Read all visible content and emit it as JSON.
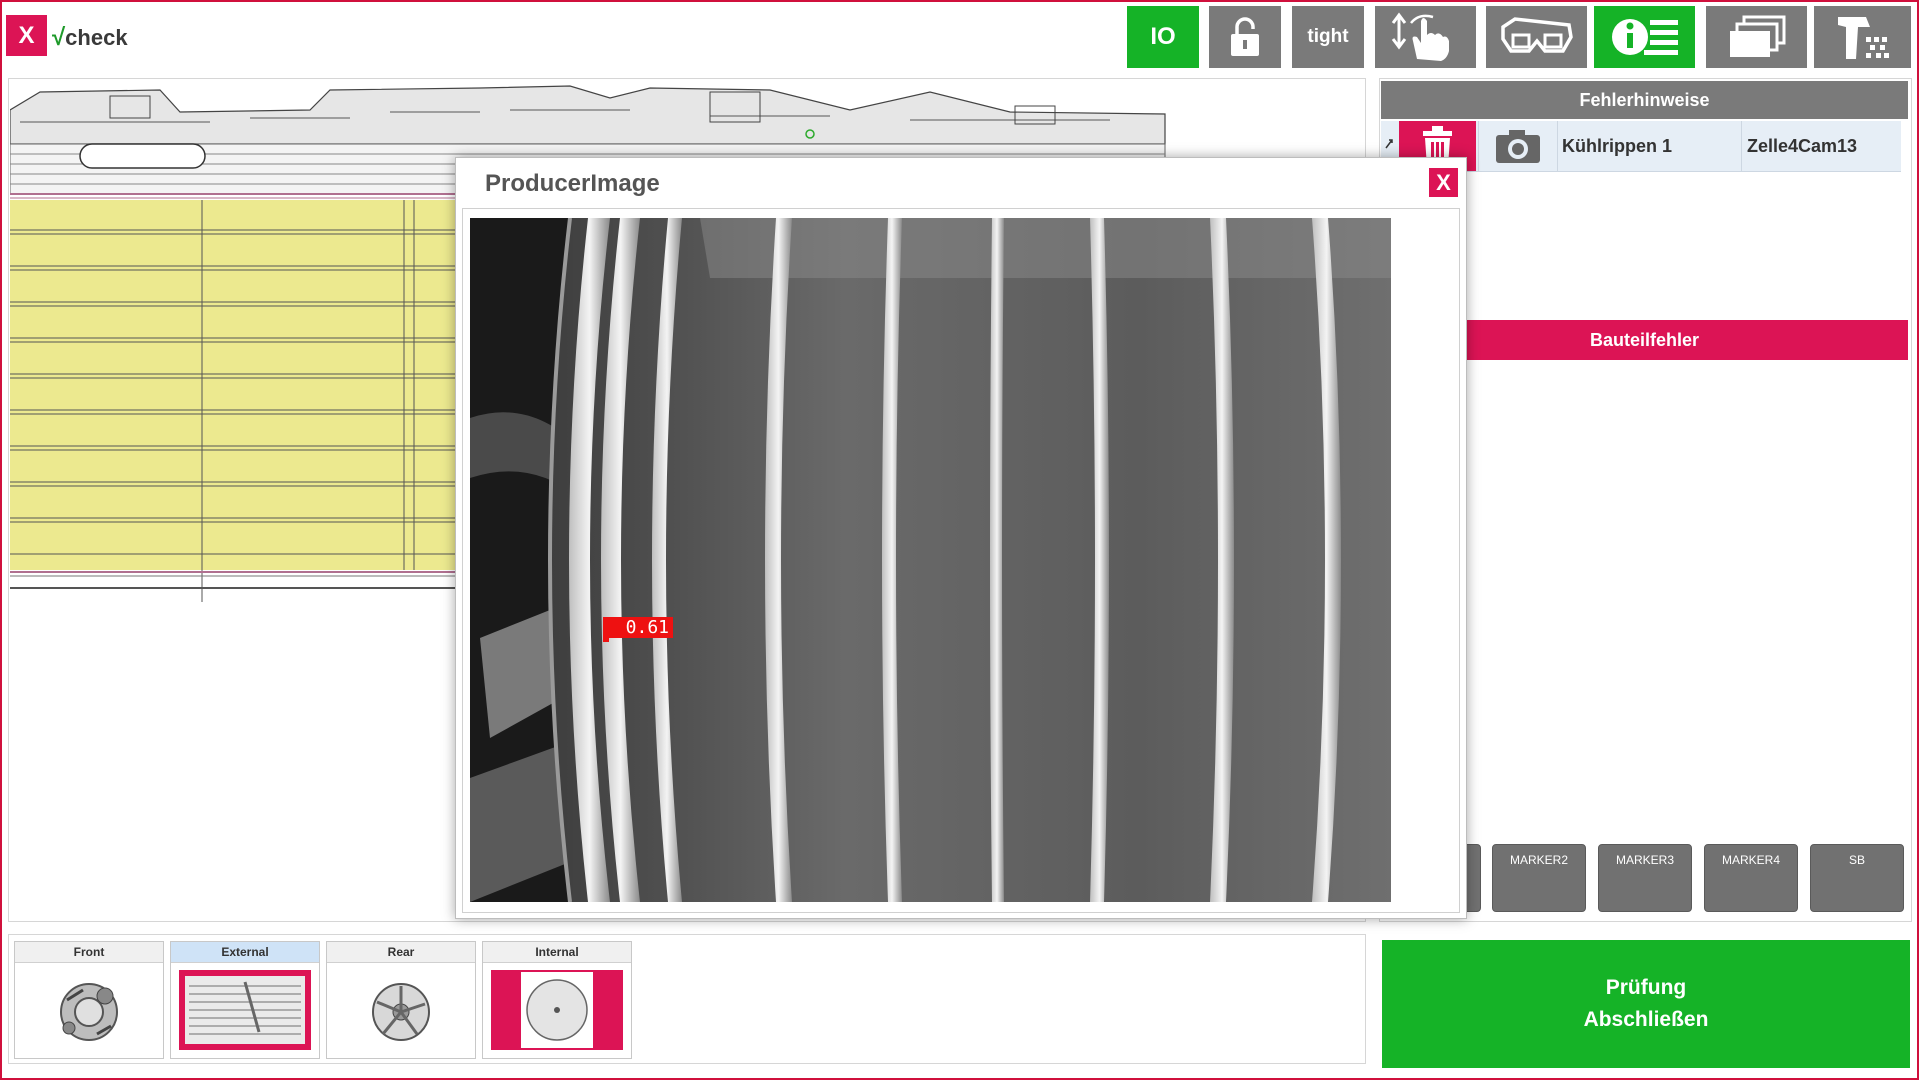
{
  "app": {
    "close_label": "X",
    "logo_check": "√",
    "logo_text": "check"
  },
  "toolbar": {
    "io_label": "IO",
    "lock_icon": "lock-open-icon",
    "tight_label": "tight",
    "gesture_icon": "swipe-hand-icon",
    "glasses_icon": "3d-glasses-icon",
    "info_icon": "info-list-icon",
    "layers_icon": "stacked-windows-icon",
    "scanner_icon": "barcode-scanner-icon"
  },
  "hints": {
    "header": "Fehlerhinweise",
    "rows": [
      {
        "name": "Kühlrippen 1",
        "camera": "Zelle4Cam13"
      }
    ]
  },
  "defects": {
    "header": "Bauteilfehler"
  },
  "markers": [
    "",
    "MARKER2",
    "MARKER3",
    "MARKER4",
    "SB"
  ],
  "finish": {
    "line1": "Prüfung",
    "line2": "Abschließen"
  },
  "views": [
    {
      "label": "Front",
      "active": false
    },
    {
      "label": "External",
      "active": true
    },
    {
      "label": "Rear",
      "active": false
    },
    {
      "label": "Internal",
      "active": false
    }
  ],
  "popup": {
    "title": "ProducerImage",
    "close_label": "X",
    "score": "0.61"
  },
  "colors": {
    "accent_red": "#dc1455",
    "accent_green": "#15b327",
    "button_gray": "#7a7a7a",
    "highlight_yellow": "#ece98f"
  }
}
